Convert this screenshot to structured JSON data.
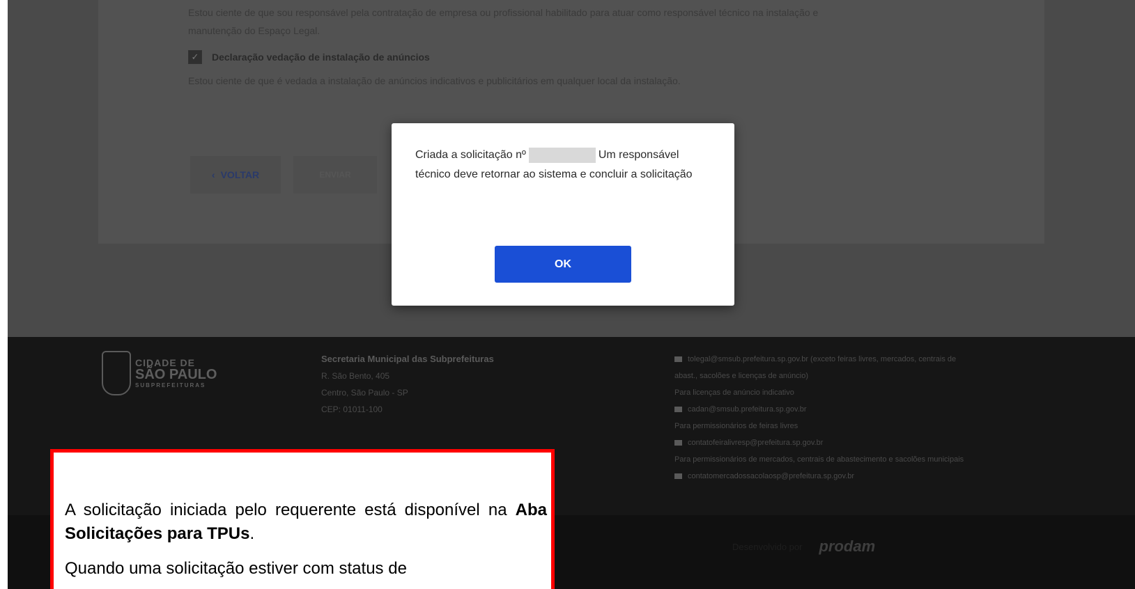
{
  "page": {
    "declaration_text_1": "Estou ciente de que sou responsável pela contratação de empresa ou profissional habilitado para atuar como responsável técnico na instalação e",
    "declaration_text_1b": "manutenção do Espaço Legal.",
    "declaration_title": "Declaração vedação de instalação de anúncios",
    "declaration_text_2": "Estou ciente de que é vedada a instalação de anúncios indicativos e publicitários em qualquer local da instalação.",
    "back_label": "VOLTAR",
    "next_label": "ENVIAR"
  },
  "modal": {
    "message_prefix": "Criada a solicitação nº",
    "message_suffix": "Um responsável técnico deve retornar ao sistema e concluir a solicitação",
    "ok_label": "OK"
  },
  "footer": {
    "logo_line1": "CIDADE DE",
    "logo_line2": "SÃO PAULO",
    "logo_line3": "SUBPREFEITURAS",
    "org_title": "Secretaria Municipal das Subprefeituras",
    "address_line1": "R. São Bento, 405",
    "address_line2": "Centro, São Paulo - SP",
    "address_line3": "CEP: 01011-100",
    "contacts": [
      {
        "type": "email",
        "text": "tolegal@smsub.prefeitura.sp.gov.br (exceto feiras livres, mercados, centrais de"
      },
      {
        "type": "text",
        "text": "abast., sacolões e licenças de anúncio)"
      },
      {
        "type": "text",
        "text": "Para licenças de anúncio indicativo"
      },
      {
        "type": "email",
        "text": "cadan@smsub.prefeitura.sp.gov.br"
      },
      {
        "type": "text",
        "text": "Para permissionários de feiras livres"
      },
      {
        "type": "email",
        "text": "contatofeiralivresp@prefeitura.sp.gov.br"
      },
      {
        "type": "text",
        "text": "Para permissionários de mercados, centrais de abastecimento e sacolões municipais"
      },
      {
        "type": "email",
        "text": "contatomercadossacolaosp@prefeitura.sp.gov.br"
      }
    ],
    "dev_label": "Desenvolvido por",
    "dev_brand": "prodam"
  },
  "callout": {
    "p1_prefix": "A solicitação iniciada pelo requerente está disponível na ",
    "p1_bold": "Aba Solicitações para TPUs",
    "p1_suffix": ".",
    "p2": "Quando uma solicitação estiver com status de"
  },
  "colors": {
    "ok_button": "#1a4fd6",
    "callout_border": "#ff0000",
    "overlay": "#4a4a4a"
  }
}
